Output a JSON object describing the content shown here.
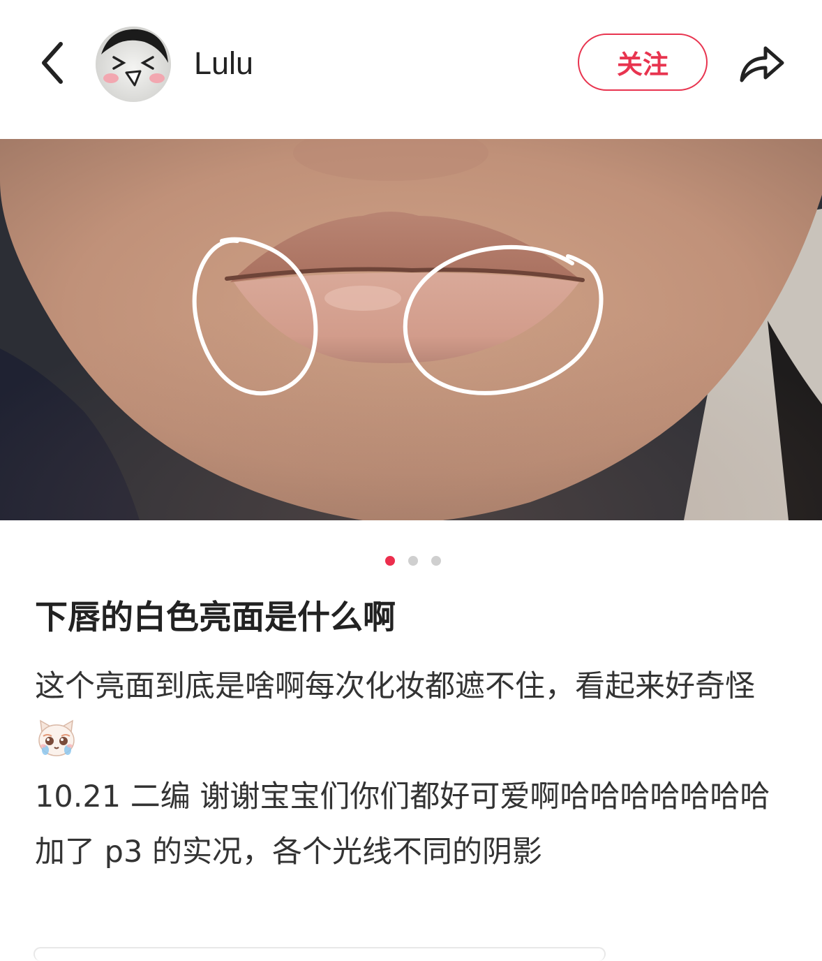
{
  "header": {
    "back_icon": "chevron-left-icon",
    "username": "Lulu",
    "follow_label": "关注",
    "share_icon": "share-arrow-icon",
    "accent_color": "#e8344f"
  },
  "carousel": {
    "total": 3,
    "active_index": 0
  },
  "post": {
    "title": "下唇的白色亮面是什么啊",
    "lines": [
      "这个亮面到底是啥啊每次化妆都遮不住，看起来好奇怪",
      "10.21 二编 谢谢宝宝们你们都好可爱啊哈哈哈哈哈哈哈",
      "加了 p3 的实况，各个光线不同的阴影"
    ],
    "emoji_name": "crying-cat-emoji"
  }
}
